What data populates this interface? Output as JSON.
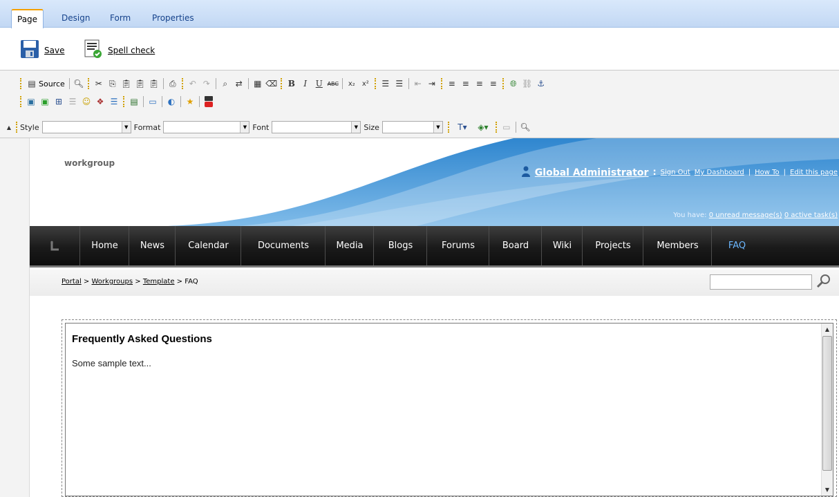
{
  "tabs": [
    {
      "label": "Page",
      "active": true
    },
    {
      "label": "Design"
    },
    {
      "label": "Form"
    },
    {
      "label": "Properties"
    }
  ],
  "actions": {
    "save_label": "Save",
    "spell_label": "Spell check"
  },
  "editor": {
    "source_label": "Source",
    "combos": {
      "style": "Style",
      "format": "Format",
      "font": "Font",
      "size": "Size"
    }
  },
  "header": {
    "brand": "workgroup",
    "admin_name": "Global Administrator",
    "colon": ":",
    "links": [
      "Sign Out",
      "My Dashboard",
      "How To",
      "Edit this page"
    ],
    "pipe": "|",
    "messages_prefix": "You have:",
    "unread": "0 unread message(s)",
    "tasks": "0 active task(s)"
  },
  "nav": {
    "items": [
      "Home",
      "News",
      "Calendar",
      "Documents",
      "Media",
      "Blogs",
      "Forums",
      "Board",
      "Wiki",
      "Projects",
      "Members",
      "FAQ"
    ],
    "active": "FAQ"
  },
  "breadcrumb": {
    "items": [
      "Portal",
      "Workgroups",
      "Template"
    ],
    "current": "FAQ",
    "separator": ">"
  },
  "content": {
    "title": "Frequently Asked Questions",
    "body": "Some sample text..."
  },
  "colors": {
    "accent": "#6bb7ff",
    "tab_highlight": "#f5a000",
    "nav_bg": "#1a1a1a",
    "header_blue": "#1f74c3"
  }
}
